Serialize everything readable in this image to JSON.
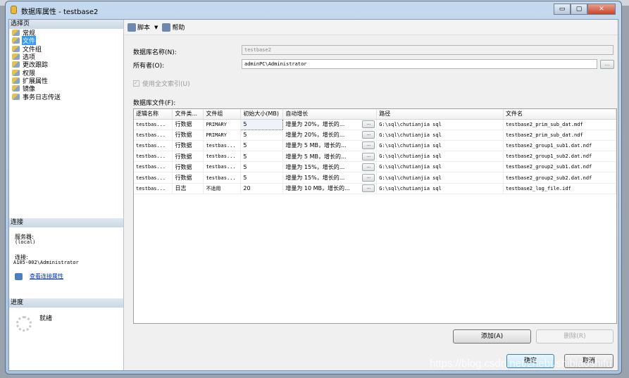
{
  "window": {
    "title": "数据库属性 - testbase2",
    "minimize": "▭",
    "maximize": "▢",
    "close": "✕"
  },
  "sidebar": {
    "header": "选择页",
    "items": [
      {
        "label": "常规"
      },
      {
        "label": "文件",
        "selected": true
      },
      {
        "label": "文件组"
      },
      {
        "label": "选项"
      },
      {
        "label": "更改跟踪"
      },
      {
        "label": "权限"
      },
      {
        "label": "扩展属性"
      },
      {
        "label": "镜像"
      },
      {
        "label": "事务日志传送"
      }
    ],
    "connection": {
      "header": "连接",
      "server_label": "服务器:",
      "server": "(local)",
      "conn_label": "连接:",
      "conn": "A105-002\\Administrator",
      "view_link": "查看连接属性"
    },
    "progress": {
      "header": "进度",
      "status": "就绪"
    }
  },
  "toolbar": {
    "script": "脚本",
    "dropdown": "▼",
    "help": "帮助"
  },
  "form": {
    "db_name_label": "数据库名称(N):",
    "db_name": "testbase2",
    "owner_label": "所有者(O):",
    "owner": "adminPC\\Administrator",
    "browse": "...",
    "fulltext_label": "使用全文索引(U)",
    "files_label": "数据库文件(F):"
  },
  "grid": {
    "columns": [
      "逻辑名称",
      "文件类...",
      "文件组",
      "初始大小(MB)",
      "自动增长",
      "路径",
      "文件名"
    ],
    "rows": [
      [
        "testbas...",
        "行数据",
        "PRIMARY",
        "5",
        "增量为 20%，增长的...",
        "G:\\sql\\chutianjia sql",
        "testbase2_prim_sub_dat.mdf"
      ],
      [
        "testbas...",
        "行数据",
        "PRIMARY",
        "5",
        "增量为 20%，增长的...",
        "G:\\sql\\chutianjia sql",
        "testbase2_prim_sub_dat.ndf"
      ],
      [
        "testbas...",
        "行数据",
        "testbas...",
        "5",
        "增量为 5 MB，增长的...",
        "G:\\sql\\chutianjia sql",
        "testbase2_group1_sub1.dat.ndf"
      ],
      [
        "testbas...",
        "行数据",
        "testbas...",
        "5",
        "增量为 5 MB，增长的...",
        "G:\\sql\\chutianjia sql",
        "testbase2_group1_sub2.dat.ndf"
      ],
      [
        "testbas...",
        "行数据",
        "testbas...",
        "5",
        "增量为 15%，增长的...",
        "G:\\sql\\chutianjia sql",
        "testbase2_group2_sub1.dat.ndf"
      ],
      [
        "testbas...",
        "行数据",
        "testbas...",
        "5",
        "增量为 15%，增长的...",
        "G:\\sql\\chutianjia sql",
        "testbase2_group2_sub2.dat.ndf"
      ],
      [
        "testbas...",
        "日志",
        "不适用",
        "20",
        "增量为 10 MB，增长的...",
        "G:\\sql\\chutianjia sql",
        "testbase2_log_file.idf"
      ]
    ],
    "cell_button": "..."
  },
  "buttons": {
    "add": "添加(A)",
    "remove": "删除(R)",
    "ok": "确定",
    "cancel": "取消"
  },
  "watermark": "https://blog.csdn.net/zhebushibiaoshifu"
}
